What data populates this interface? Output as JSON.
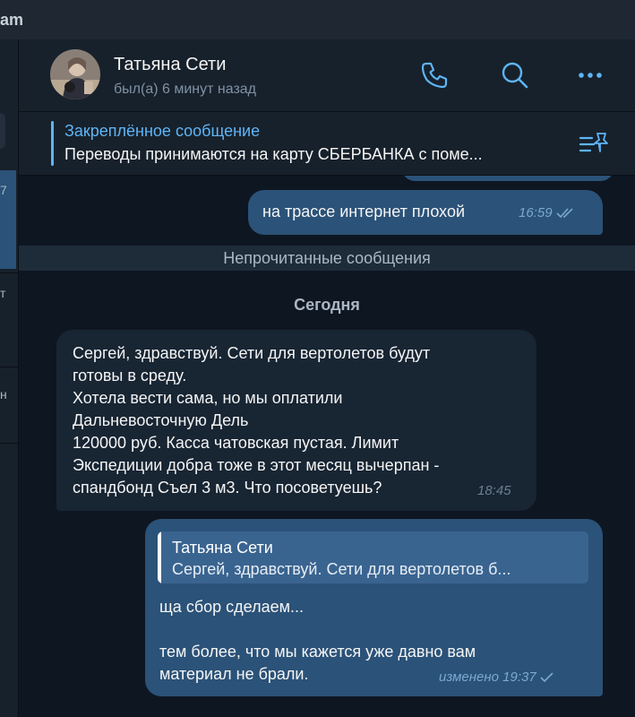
{
  "app": {
    "title_fragment": "am"
  },
  "sidebar": {
    "fragments": [
      "7",
      "т",
      "н"
    ]
  },
  "header": {
    "name": "Татьяна Сети",
    "status": "был(а) 6 минут назад",
    "icons": [
      "phone-icon",
      "search-icon",
      "more-icon"
    ]
  },
  "pinned": {
    "title": "Закреплённое сообщение",
    "text": "Переводы принимаются на карту СБЕРБАНКА с поме..."
  },
  "messages": {
    "out1": {
      "text": "на трассе интернет плохой",
      "time": "16:59"
    },
    "unread_label": "Непрочитанные сообщения",
    "date_label": "Сегодня",
    "in1": {
      "lines": [
        "Сергей, здравствуй. Сети для вертолетов будут",
        "готовы в среду.",
        "Хотела вести сама, но мы оплатили",
        "Дальневосточную Дель",
        "120000 руб. Касса чатовская пустая. Лимит",
        "Экспедиции добра тоже в этот месяц вычерпан -",
        "спандбонд Съел 3 м3. Что посоветуешь?"
      ],
      "time": "18:45"
    },
    "out2": {
      "reply": {
        "name": "Татьяна Сети",
        "text": "Сергей, здравствуй. Сети для вертолетов б..."
      },
      "lines": [
        "ща сбор сделаем...",
        "",
        "тем более, что мы кажется уже давно вам",
        "материал не брали."
      ],
      "edited": "изменено",
      "time": "19:37"
    }
  },
  "colors": {
    "background": "#0e1621",
    "panel": "#17212b",
    "outgoing_bubble": "#2b5278",
    "incoming_bubble": "#182533",
    "accent": "#5eb5f7"
  }
}
